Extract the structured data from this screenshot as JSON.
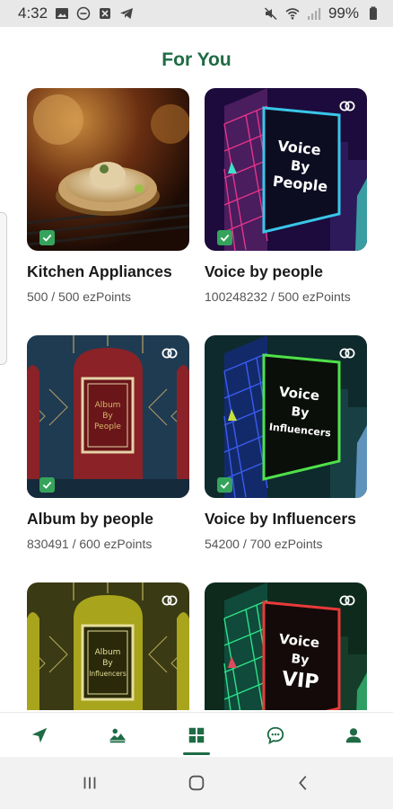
{
  "status_bar": {
    "time": "4:32",
    "battery": "99%"
  },
  "header": {
    "title": "For You"
  },
  "cards": [
    {
      "title": "Kitchen Appliances",
      "points": "500 / 500 ezPoints",
      "image": "kitchen-appliances-image",
      "checked": true,
      "linked": false
    },
    {
      "title": "Voice by people",
      "points": "100248232 / 500 ezPoints",
      "image": "voice-by-people-billboard",
      "image_text": [
        "Voice",
        "By",
        "People"
      ],
      "checked": true,
      "linked": true
    },
    {
      "title": "Album by people",
      "points": "830491 / 600 ezPoints",
      "image": "album-by-people-arch",
      "image_text": [
        "Album",
        "By",
        "People"
      ],
      "checked": true,
      "linked": true
    },
    {
      "title": "Voice by Influencers",
      "points": "54200 / 700 ezPoints",
      "image": "voice-by-influencers-billboard",
      "image_text": [
        "Voice",
        "By",
        "Influencers"
      ],
      "checked": true,
      "linked": true
    },
    {
      "title": "",
      "points": "",
      "image": "album-by-influencers-arch",
      "image_text": [
        "Album",
        "By",
        "Influencers"
      ],
      "checked": false,
      "linked": true
    },
    {
      "title": "",
      "points": "",
      "image": "voice-by-vip-billboard",
      "image_text": [
        "Voice",
        "By",
        "VIP"
      ],
      "checked": false,
      "linked": true
    }
  ],
  "bottom_nav": {
    "items": [
      "navigate-icon",
      "landscape-icon",
      "dashboard-icon",
      "chat-icon",
      "profile-icon"
    ],
    "active": "dashboard-icon"
  },
  "system_nav": [
    "recents-icon",
    "home-icon",
    "back-icon"
  ],
  "colors": {
    "brand": "#1e6b45",
    "check": "#36a35c"
  }
}
